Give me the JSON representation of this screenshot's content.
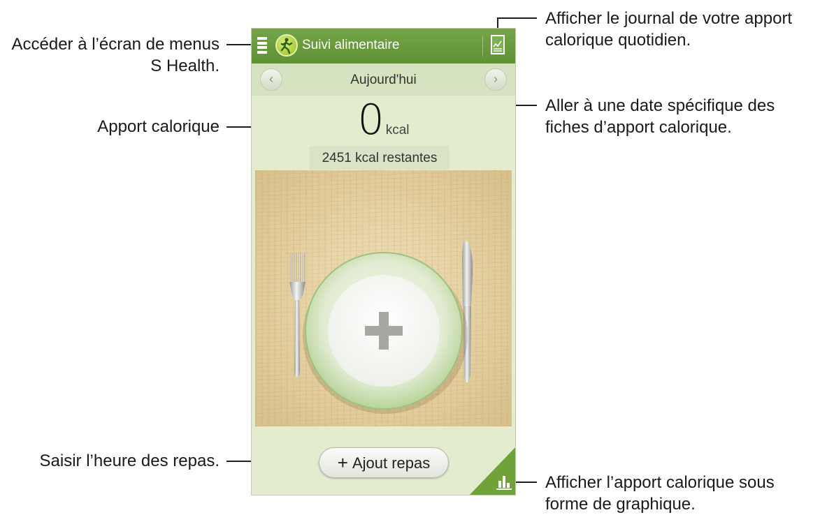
{
  "annotations": {
    "menu": [
      "Accéder à l’écran de menus",
      "S Health."
    ],
    "calorie_intake": "Apport calorique",
    "meal_time": "Saisir l’heure des repas.",
    "journal": [
      "Afficher le journal de votre apport",
      "calorique quotidien."
    ],
    "date": [
      "Aller à une date spécifique des",
      "fiches d’apport calorique."
    ],
    "graph": [
      "Afficher l’apport calorique sous",
      "forme de graphique."
    ]
  },
  "app": {
    "title": "Suivi alimentaire",
    "date_label": "Aujourd'hui",
    "prev_arrow": "‹",
    "next_arrow": "›",
    "calorie_value": "0",
    "calorie_unit": "kcal",
    "remaining": "2451 kcal restantes",
    "add_meal_label": "Ajout repas",
    "add_meal_plus": "+"
  },
  "colors": {
    "action_bar": "#6b9d3f",
    "screen_background": "#e3eccf",
    "date_bar": "#d6e3c0",
    "graph_corner": "#6fa33a"
  },
  "icons": [
    "menu-icon",
    "app-logo-icon",
    "journal-icon",
    "plate-add-icon",
    "graph-icon"
  ]
}
